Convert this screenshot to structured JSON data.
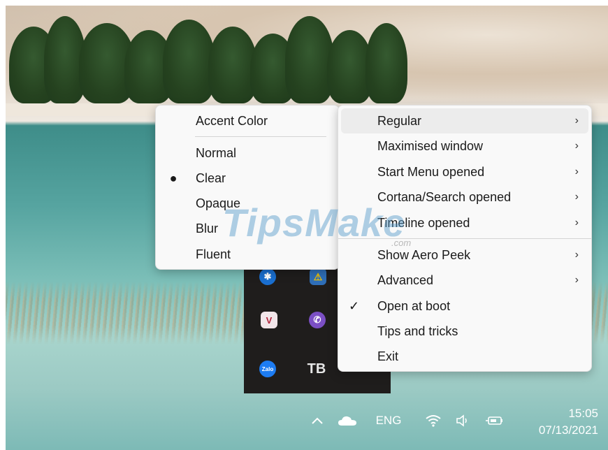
{
  "accent_menu": {
    "header": "Accent Color",
    "items": [
      {
        "label": "Normal",
        "selected": false
      },
      {
        "label": "Clear",
        "selected": true
      },
      {
        "label": "Opaque",
        "selected": false
      },
      {
        "label": "Blur",
        "selected": false
      },
      {
        "label": "Fluent",
        "selected": false
      }
    ]
  },
  "main_menu": {
    "items": [
      {
        "label": "Regular",
        "submenu": true
      },
      {
        "label": "Maximised window",
        "submenu": true
      },
      {
        "label": "Start Menu opened",
        "submenu": true
      },
      {
        "label": "Cortana/Search opened",
        "submenu": true
      },
      {
        "label": "Timeline opened",
        "submenu": true
      },
      {
        "label": "Show Aero Peek",
        "submenu": true
      },
      {
        "label": "Advanced",
        "submenu": true
      },
      {
        "label": "Open at boot",
        "checked": true
      },
      {
        "label": "Tips and tricks"
      },
      {
        "label": "Exit"
      }
    ]
  },
  "tray_overflow": {
    "icons": [
      "bluetooth-icon",
      "warning-shield-icon",
      "v-app-icon",
      "viber-icon",
      "zalo-icon",
      "translucenttb-icon"
    ],
    "zalo_label": "Zalo",
    "tb_label": "TB",
    "v_label": "V"
  },
  "watermark": {
    "text": "TipsMake",
    "sub": ".com"
  },
  "taskbar": {
    "language": "ENG",
    "time": "15:05",
    "date": "07/13/2021"
  },
  "colors": {
    "menu_bg": "#f9f9f9",
    "highlight": "#ececec",
    "tray_bg": "#1f1d1c"
  }
}
